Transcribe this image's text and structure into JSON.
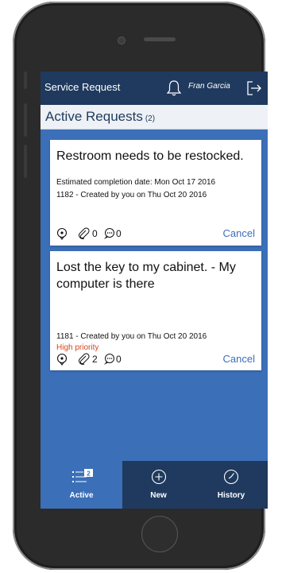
{
  "header": {
    "title": "Service Request",
    "user_name": "Fran Garcia"
  },
  "section": {
    "title": "Active Requests",
    "count": "(2)"
  },
  "requests": [
    {
      "title": "Restroom needs to be restocked.",
      "estimate": "Estimated completion date: Mon Oct 17 2016",
      "meta": "1182 - Created by you on Thu Oct 20 2016",
      "attachments": "0",
      "comments": "0",
      "action": "Cancel"
    },
    {
      "title": "Lost the key to my cabinet. - My computer is there",
      "meta": "1181 - Created by you on Thu Oct 20 2016",
      "priority": "High priority",
      "attachments": "2",
      "comments": "0",
      "action": "Cancel"
    }
  ],
  "tabs": [
    {
      "label": "Active",
      "badge": "2",
      "icon": "list-icon"
    },
    {
      "label": "New",
      "icon": "plus-icon"
    },
    {
      "label": "History",
      "icon": "clock-icon"
    }
  ],
  "colors": {
    "header": "#1f3a5e",
    "accent": "#3b6fb8",
    "priority": "#d6451f"
  }
}
